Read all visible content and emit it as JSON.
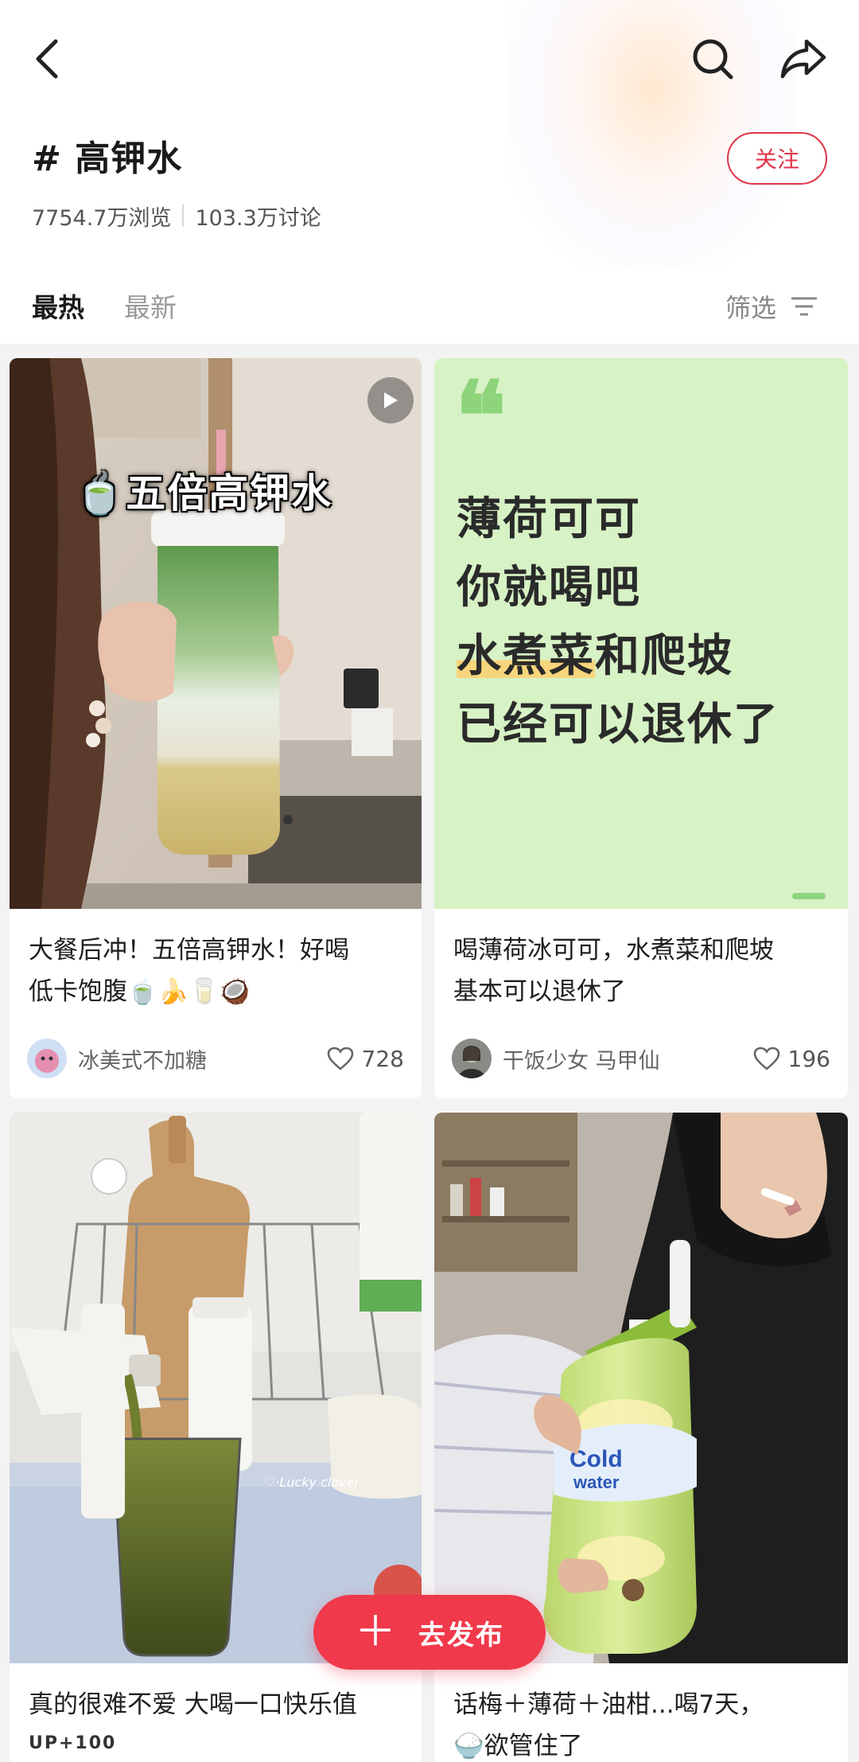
{
  "topic": {
    "hash": "#",
    "title": "高钾水",
    "follow_label": "关注",
    "views": "7754.7万浏览",
    "discussions": "103.3万讨论"
  },
  "tabs": [
    {
      "label": "最热",
      "active": true
    },
    {
      "label": "最新",
      "active": false
    }
  ],
  "filter_label": "筛选",
  "posts": [
    {
      "image_caption": "五倍高钾水",
      "title_line1": "大餐后冲！五倍高钾水！好喝",
      "title_line2": "低卡饱腹🍵🍌🥛🥥",
      "author": "冰美式不加糖",
      "likes": "728"
    },
    {
      "quote_mark": "❝",
      "quote_line1": "薄荷可可",
      "quote_line2": "你就喝吧",
      "quote_line3_hl": "水煮菜",
      "quote_line3_rest": "和爬坡",
      "quote_line4": "已经可以退休了",
      "title_line1": "喝薄荷冰可可，水煮菜和爬坡",
      "title_line2": "基本可以退休了",
      "author": "干饭少女 马甲仙",
      "likes": "196"
    },
    {
      "title": "真的很难不爱 大喝一口快乐值",
      "subline": "UP+100"
    },
    {
      "title_line1": "话梅＋薄荷＋油柑...喝7天，",
      "title_line2": "🍚欲管住了"
    }
  ],
  "publish_label": "去发布",
  "colors": {
    "accent": "#f0394a",
    "quote_bg": "#d7f2c5",
    "highlight": "#f7d57c"
  },
  "icons": [
    "back-arrow-icon",
    "search-icon",
    "share-icon",
    "filter-icon",
    "heart-icon",
    "play-icon",
    "plus-icon"
  ]
}
